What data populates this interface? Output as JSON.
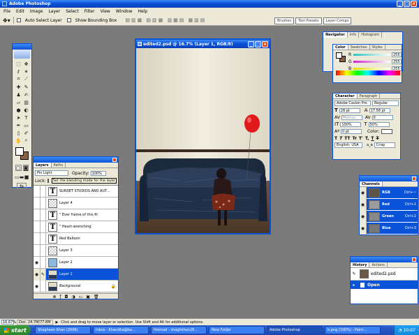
{
  "app": {
    "title": "Adobe Photoshop"
  },
  "menu": [
    "File",
    "Edit",
    "Image",
    "Layer",
    "Select",
    "Filter",
    "View",
    "Window",
    "Help"
  ],
  "options_bar": {
    "auto_select": "Auto Select Layer",
    "bounding_box": "Show Bounding Box"
  },
  "palette_well_tabs": [
    "Brushes",
    "Tool Presets",
    "Layer Comps"
  ],
  "document": {
    "title": "edited2.psd @ 16.7% (Layer 1, RGB/8)"
  },
  "navigator": {
    "tabs": [
      "Navigator",
      "Info",
      "Histogram"
    ]
  },
  "color": {
    "tabs": [
      "Color",
      "Swatches",
      "Styles"
    ],
    "sliders": [
      {
        "label": "R",
        "value": "255",
        "color": "#2ec4c4"
      },
      {
        "label": "G",
        "value": "255",
        "color": "#d020d0"
      },
      {
        "label": "B",
        "value": "255",
        "color": "#e0e000"
      }
    ]
  },
  "character": {
    "tabs": [
      "Character",
      "Paragraph"
    ],
    "font": "Adobe Caslon Pro",
    "style": "Regular",
    "size": "28 pt",
    "leading": "17.58 pt",
    "kerning": "Metrics",
    "tracking": "0",
    "vscale": "100%",
    "hscale": "50%",
    "baseline": "0 pt",
    "color_label": "Color:",
    "language": "English: USA",
    "aa_label": "a_a",
    "aa": "Crisp",
    "style_buttons": [
      "T",
      "T",
      "TT",
      "Tr",
      "T'",
      "T,",
      "T",
      "T"
    ]
  },
  "channels": {
    "tabs": [
      "Channels"
    ],
    "items": [
      "RGB",
      "Red",
      "Green",
      "Blue"
    ],
    "shortcuts": [
      "Ctrl+~",
      "Ctrl+1",
      "Ctrl+2",
      "Ctrl+3"
    ]
  },
  "history": {
    "tabs": [
      "History",
      "Actions"
    ],
    "snapshot": "edited2.psd",
    "items": [
      "Open"
    ]
  },
  "layers": {
    "tabs": [
      "Layers",
      "Paths"
    ],
    "blend": "Pin Light",
    "opacity_label": "Opacity:",
    "opacity": "100%",
    "lock_label": "Lock:",
    "tooltip": "Set the blending mode for the layer",
    "items": [
      {
        "name": "SUNSET STUDIOS AND AUT...",
        "type": "text"
      },
      {
        "name": "Layer 4",
        "type": "transparent"
      },
      {
        "name": "\" Ever frame of       this fil",
        "type": "text"
      },
      {
        "name": "\" Heart-wrenching",
        "type": "text"
      },
      {
        "name": "Red Balloon",
        "type": "text"
      },
      {
        "name": "Layer 3",
        "type": "transparent"
      },
      {
        "name": "Layer 2",
        "type": "blue"
      },
      {
        "name": "Layer 1",
        "type": "photo"
      },
      {
        "name": "Background",
        "type": "photo"
      }
    ]
  },
  "status": {
    "zoom": "16.67%",
    "doc": "Doc: 24.7M/77.8M",
    "hint": "Click and drag to move layer or selection.  Use Shift and Alt for additional options."
  },
  "taskbar": {
    "start": "start",
    "tasks": [
      "Shagheen Khan (2006)",
      "Inbox - Khandha@ba...",
      "Hotmail - shaghkhan26...",
      "New Folder",
      "Adobe Photoshop",
      "b.png (100%) - Paint..."
    ],
    "clock": "10:07"
  }
}
